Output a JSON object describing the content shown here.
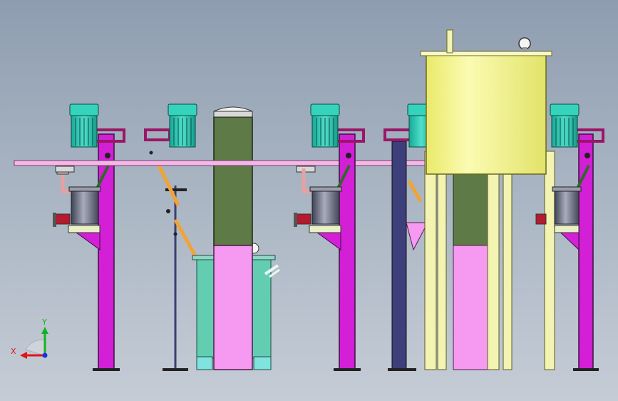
{
  "viewport": {
    "background_top": "#8e9db0",
    "background_bottom": "#c5ccd6"
  },
  "colors": {
    "frame_magenta": "#d31fd6",
    "motor_teal": "#23c8b4",
    "pipe_pink": "#f2b8e6",
    "reactor_green": "#5e7a46",
    "reactor_pink": "#f59af0",
    "tank_teal": "#63cdb1",
    "big_tank_yellow": "#f4f58c",
    "legs_cream": "#f3f3b2",
    "strut_orange": "#f2a332",
    "vessel_steel": "#7f8494",
    "column_navy": "#3c3f7a"
  },
  "triad": {
    "x_label": "X",
    "y_label": "Y",
    "x_color": "#e0141a",
    "y_color": "#11b41f",
    "z_color": "#1a2fe0"
  }
}
